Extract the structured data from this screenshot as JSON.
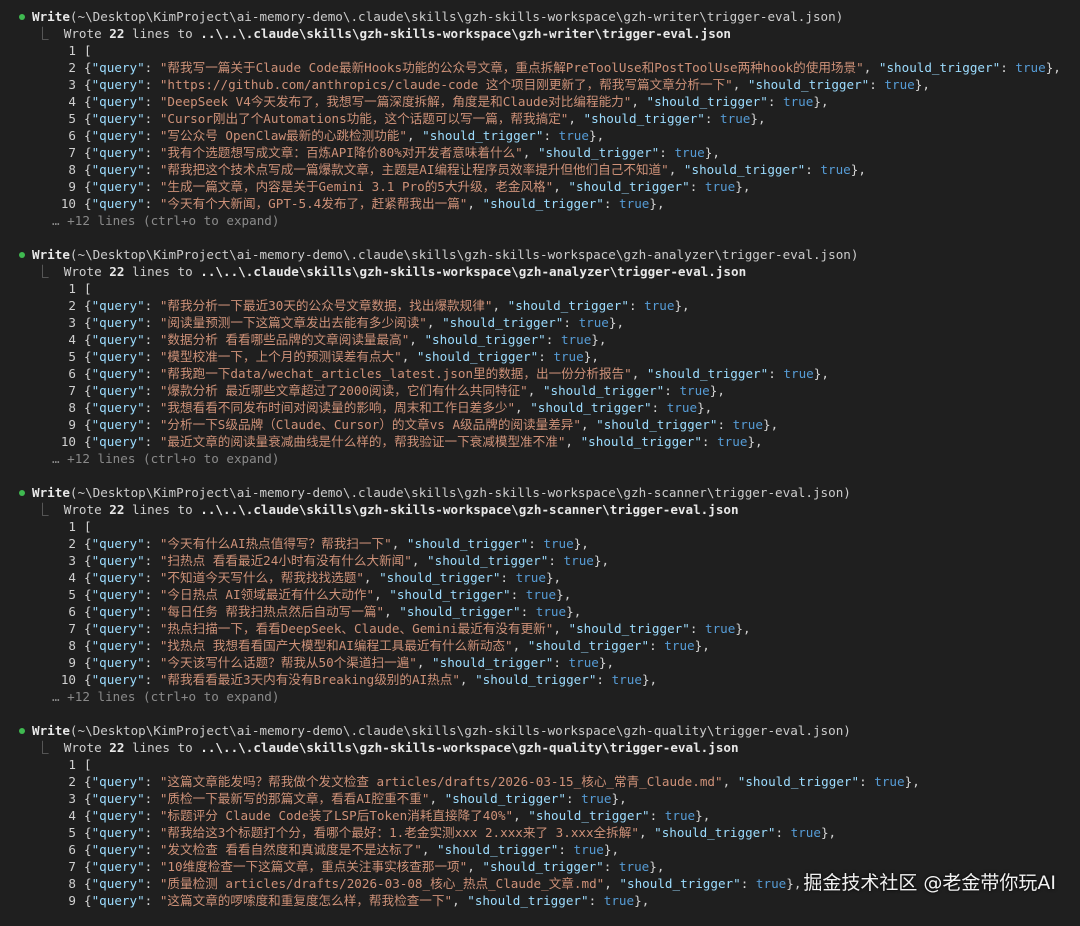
{
  "blocks": [
    {
      "command": "Write",
      "path": "(~\\Desktop\\KimProject\\ai-memory-demo\\.claude\\skills\\gzh-skills-workspace\\gzh-writer\\trigger-eval.json)",
      "wrote_prefix": "Wrote ",
      "line_count": "22",
      "wrote_mid": " lines to ",
      "rel_path": "..\\..\\.claude\\skills\\gzh-skills-workspace\\gzh-writer\\trigger-eval.json",
      "first_line": "[",
      "entries": [
        {
          "num": "2",
          "query": "\"帮我写一篇关于Claude Code最新Hooks功能的公众号文章，重点拆解PreToolUse和PostToolUse两种hook的使用场景\""
        },
        {
          "num": "3",
          "query": "\"https://github.com/anthropics/claude-code 这个项目刚更新了，帮我写篇文章分析一下\""
        },
        {
          "num": "4",
          "query": "\"DeepSeek V4今天发布了，我想写一篇深度拆解，角度是和Claude对比编程能力\""
        },
        {
          "num": "5",
          "query": "\"Cursor刚出了个Automations功能，这个话题可以写一篇，帮我搞定\""
        },
        {
          "num": "6",
          "query": "\"写公众号 OpenClaw最新的心跳检测功能\""
        },
        {
          "num": "7",
          "query": "\"我有个选题想写成文章：百炼API降价80%对开发者意味着什么\""
        },
        {
          "num": "8",
          "query": "\"帮我把这个技术点写成一篇爆款文章，主题是AI编程让程序员效率提升但他们自己不知道\""
        },
        {
          "num": "9",
          "query": "\"生成一篇文章，内容是关于Gemini 3.1 Pro的5大升级，老金风格\""
        },
        {
          "num": "10",
          "query": "\"今天有个大新闻，GPT-5.4发布了，赶紧帮我出一篇\""
        }
      ],
      "more": "… +12 lines (ctrl+o to expand)"
    },
    {
      "command": "Write",
      "path": "(~\\Desktop\\KimProject\\ai-memory-demo\\.claude\\skills\\gzh-skills-workspace\\gzh-analyzer\\trigger-eval.json)",
      "wrote_prefix": "Wrote ",
      "line_count": "22",
      "wrote_mid": " lines to ",
      "rel_path": "..\\..\\.claude\\skills\\gzh-skills-workspace\\gzh-analyzer\\trigger-eval.json",
      "first_line": "[",
      "entries": [
        {
          "num": "2",
          "query": "\"帮我分析一下最近30天的公众号文章数据，找出爆款规律\""
        },
        {
          "num": "3",
          "query": "\"阅读量预测一下这篇文章发出去能有多少阅读\""
        },
        {
          "num": "4",
          "query": "\"数据分析 看看哪些品牌的文章阅读量最高\""
        },
        {
          "num": "5",
          "query": "\"模型校准一下，上个月的预测误差有点大\""
        },
        {
          "num": "6",
          "query": "\"帮我跑一下data/wechat_articles_latest.json里的数据，出一份分析报告\""
        },
        {
          "num": "7",
          "query": "\"爆款分析 最近哪些文章超过了2000阅读，它们有什么共同特征\""
        },
        {
          "num": "8",
          "query": "\"我想看看不同发布时间对阅读量的影响，周末和工作日差多少\""
        },
        {
          "num": "9",
          "query": "\"分析一下S级品牌（Claude、Cursor）的文章vs A级品牌的阅读量差异\""
        },
        {
          "num": "10",
          "query": "\"最近文章的阅读量衰减曲线是什么样的，帮我验证一下衰减模型准不准\""
        }
      ],
      "more": "… +12 lines (ctrl+o to expand)"
    },
    {
      "command": "Write",
      "path": "(~\\Desktop\\KimProject\\ai-memory-demo\\.claude\\skills\\gzh-skills-workspace\\gzh-scanner\\trigger-eval.json)",
      "wrote_prefix": "Wrote ",
      "line_count": "22",
      "wrote_mid": " lines to ",
      "rel_path": "..\\..\\.claude\\skills\\gzh-skills-workspace\\gzh-scanner\\trigger-eval.json",
      "first_line": "[",
      "entries": [
        {
          "num": "2",
          "query": "\"今天有什么AI热点值得写？帮我扫一下\""
        },
        {
          "num": "3",
          "query": "\"扫热点 看看最近24小时有没有什么大新闻\""
        },
        {
          "num": "4",
          "query": "\"不知道今天写什么，帮我找找选题\""
        },
        {
          "num": "5",
          "query": "\"今日热点 AI领域最近有什么大动作\""
        },
        {
          "num": "6",
          "query": "\"每日任务 帮我扫热点然后自动写一篇\""
        },
        {
          "num": "7",
          "query": "\"热点扫描一下，看看DeepSeek、Claude、Gemini最近有没有更新\""
        },
        {
          "num": "8",
          "query": "\"找热点 我想看看国产大模型和AI编程工具最近有什么新动态\""
        },
        {
          "num": "9",
          "query": "\"今天该写什么话题？帮我从50个渠道扫一遍\""
        },
        {
          "num": "10",
          "query": "\"帮我看看最近3天内有没有Breaking级别的AI热点\""
        }
      ],
      "more": "… +12 lines (ctrl+o to expand)"
    },
    {
      "command": "Write",
      "path": "(~\\Desktop\\KimProject\\ai-memory-demo\\.claude\\skills\\gzh-skills-workspace\\gzh-quality\\trigger-eval.json)",
      "wrote_prefix": "Wrote ",
      "line_count": "22",
      "wrote_mid": " lines to ",
      "rel_path": "..\\..\\.claude\\skills\\gzh-skills-workspace\\gzh-quality\\trigger-eval.json",
      "first_line": "[",
      "entries": [
        {
          "num": "2",
          "query": "\"这篇文章能发吗？帮我做个发文检查 articles/drafts/2026-03-15_核心_常青_Claude.md\""
        },
        {
          "num": "3",
          "query": "\"质检一下最新写的那篇文章，看看AI腔重不重\""
        },
        {
          "num": "4",
          "query": "\"标题评分 Claude Code装了LSP后Token消耗直接降了40%\""
        },
        {
          "num": "5",
          "query": "\"帮我给这3个标题打个分，看哪个最好：1.老金实测xxx 2.xxx来了 3.xxx全拆解\""
        },
        {
          "num": "6",
          "query": "\"发文检查 看看自然度和真诚度是不是达标了\""
        },
        {
          "num": "7",
          "query": "\"10维度检查一下这篇文章，重点关注事实核查那一项\""
        },
        {
          "num": "8",
          "query": "\"质量检测 articles/drafts/2026-03-08_核心_热点_Claude_文章.md\""
        },
        {
          "num": "9",
          "query": "\"这篇文章的啰嗦度和重复度怎么样，帮我检查一下\""
        }
      ],
      "more": ""
    }
  ],
  "tokens": {
    "brace_open": "{",
    "brace_close": "}",
    "key_query": "\"query\"",
    "key_trigger": "\"should_trigger\"",
    "colon": ": ",
    "comma": ", ",
    "value_true": "true"
  },
  "watermark": "掘金技术社区 @老金带你玩AI",
  "colors": {
    "background": "#1f1f1f",
    "key": "#9cdcfe",
    "string": "#ce9178",
    "boolean": "#569cd6",
    "bullet": "#3fb950"
  }
}
